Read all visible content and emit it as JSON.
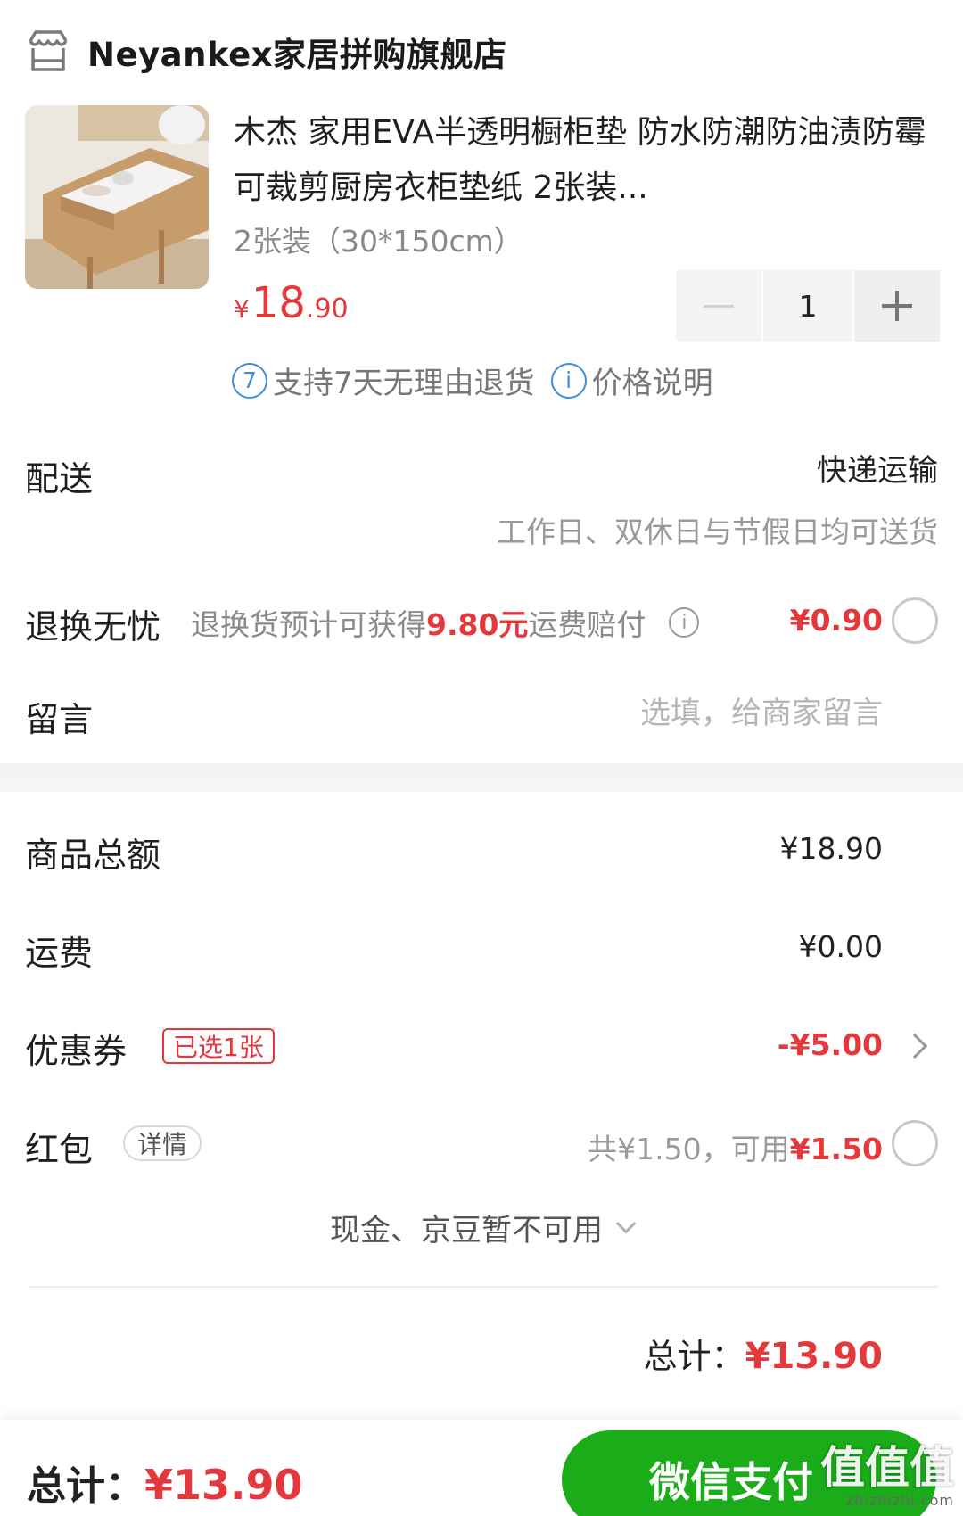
{
  "shop": {
    "name": "Neyankex家居拼购旗舰店",
    "icon": "store-icon"
  },
  "product": {
    "title": "木杰 家用EVA半透明橱柜垫 防水防潮防油渍防霉可裁剪厨房衣柜垫纸 2张装...",
    "spec": "2张装（30*150cm）",
    "price_currency": "¥",
    "price_int": "18",
    "price_dec": ".90",
    "quantity": "1",
    "services": {
      "return_badge": "7",
      "return_text": "支持7天无理由退货",
      "price_info_icon": "i",
      "price_info_text": "价格说明"
    }
  },
  "delivery": {
    "label": "配送",
    "method": "快递运输",
    "note": "工作日、双休日与节假日均可送货"
  },
  "return_insurance": {
    "label": "退换无忧",
    "desc_prefix": "退换货预计可获得",
    "desc_amount": "9.80元",
    "desc_suffix": "运费赔付",
    "info_icon": "i",
    "price": "¥0.90",
    "selected": false
  },
  "message": {
    "label": "留言",
    "placeholder": "选填，给商家留言"
  },
  "summary": {
    "goods_total_label": "商品总额",
    "goods_total_value": "¥18.90",
    "shipping_label": "运费",
    "shipping_value": "¥0.00",
    "coupon_label": "优惠券",
    "coupon_badge": "已选1张",
    "coupon_value": "-¥5.00",
    "redpacket_label": "红包",
    "redpacket_detail": "详情",
    "redpacket_prefix": "共¥1.50，可用",
    "redpacket_value": "¥1.50",
    "redpacket_selected": false,
    "cash_note": "现金、京豆暂不可用",
    "total_label": "总计：",
    "total_value": "¥13.90"
  },
  "bottom_bar": {
    "total_label": "总计：",
    "total_value": "¥13.90",
    "pay_label": "微信支付"
  },
  "watermark": {
    "big": "值值值",
    "small": "zhizhizhi.com"
  },
  "colors": {
    "accent_red": "#e4393c",
    "wechat_green": "#1aad19",
    "link_blue": "#3b8fe0"
  }
}
